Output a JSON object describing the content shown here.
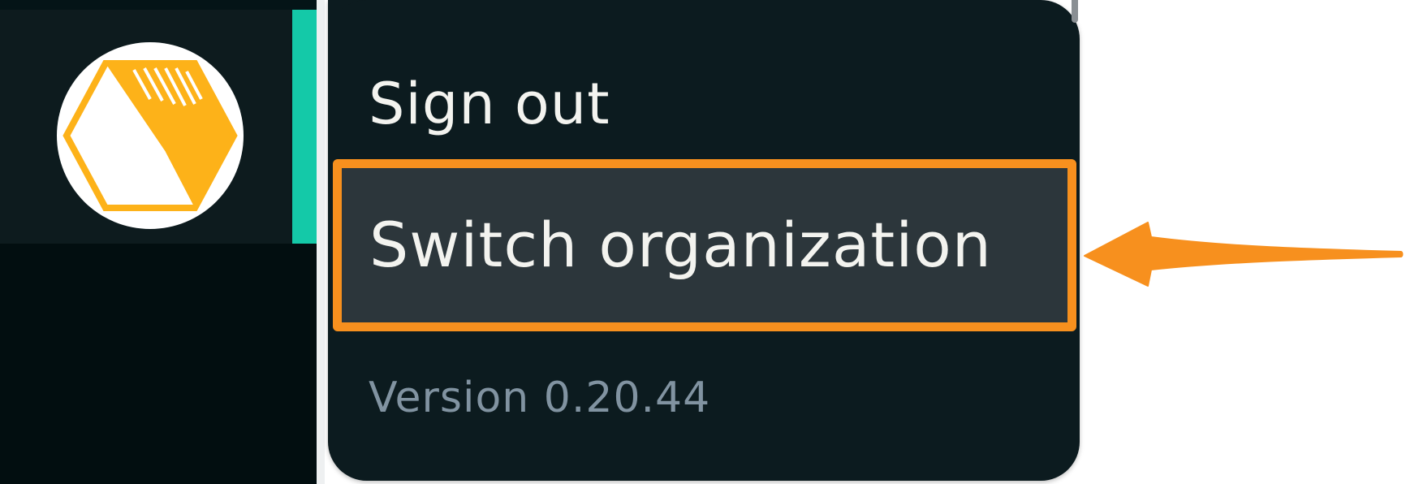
{
  "menu": {
    "items": [
      {
        "label": "Sign out"
      },
      {
        "label": "Switch organization"
      }
    ],
    "version_text": "Version 0.20.44"
  },
  "org": {
    "avatar_icon": "hexagon-logo-icon"
  },
  "colors": {
    "sidebar_background": "#020e10",
    "active_indicator": "#14c9a8",
    "menu_background": "#0c1b1f",
    "highlight_background": "#2c363b",
    "annotation_orange": "#f7901e",
    "logo_yellow": "#fdb219",
    "version_text": "#8193a1"
  }
}
